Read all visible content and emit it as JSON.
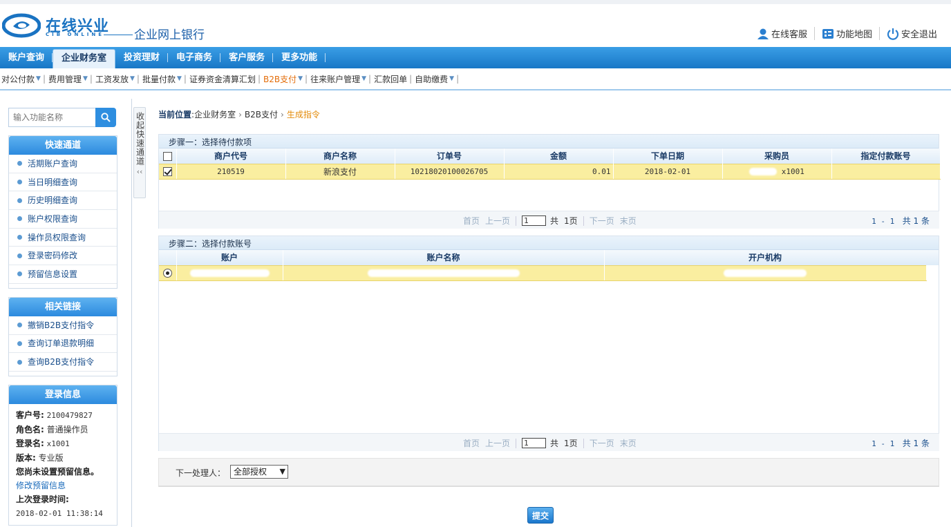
{
  "header": {
    "logo_text": "在线兴业",
    "logo_sub": "CIB ONLINE",
    "title": "企业网上银行",
    "links": [
      {
        "label": "在线客服",
        "icon": "customer-service-icon"
      },
      {
        "label": "功能地图",
        "icon": "function-map-icon"
      },
      {
        "label": "安全退出",
        "icon": "power-icon"
      }
    ]
  },
  "main_nav": [
    "账户查询",
    "企业财务室",
    "投资理财",
    "电子商务",
    "客户服务",
    "更多功能"
  ],
  "main_nav_active": "企业财务室",
  "sub_nav": [
    "对公付款",
    "费用管理",
    "工资发放",
    "批量付款",
    "证券资金清算汇划",
    "B2B支付",
    "往来账户管理",
    "汇款回单",
    "自助缴费"
  ],
  "sub_nav_active": "B2B支付",
  "sidebar": {
    "search_placeholder": "输入功能名称",
    "collapse_label": "收起快速通道",
    "quick": {
      "title": "快速通道",
      "items": [
        "活期账户查询",
        "当日明细查询",
        "历史明细查询",
        "账户权限查询",
        "操作员权限查询",
        "登录密码修改",
        "预留信息设置"
      ]
    },
    "related": {
      "title": "相关链接",
      "items": [
        "撤销B2B支付指令",
        "查询订单退款明细",
        "查询B2B支付指令"
      ]
    },
    "login": {
      "title": "登录信息",
      "customer_no_label": "客户号:",
      "customer_no": "2100479827",
      "role_label": "角色名:",
      "role": "普通操作员",
      "login_name_label": "登录名:",
      "login_name": "x1001",
      "version_label": "版本:",
      "version": "专业版",
      "notice": "您尚未设置预留信息。",
      "modify_link": "修改预留信息",
      "last_login_label": "上次登录时间:",
      "last_login": "2018-02-01 11:38:14"
    }
  },
  "breadcrumb": {
    "label": "当前位置",
    "path": [
      "企业财务室",
      "B2B支付"
    ],
    "current": "生成指令"
  },
  "step1": {
    "title": "步骤一：选择待付款项",
    "columns": [
      "商户代号",
      "商户名称",
      "订单号",
      "金额",
      "下单日期",
      "采购员",
      "指定付款账号"
    ],
    "rows": [
      {
        "checked": true,
        "merchant_code": "210519",
        "merchant_name": "新浪支付",
        "order_no": "10218020100026705",
        "amount": "0.01",
        "date": "2018-02-01",
        "buyer": "x1001",
        "account": ""
      }
    ]
  },
  "pager": {
    "first": "首页",
    "prev": "上一页",
    "page": "1",
    "total_prefix": "共",
    "total_pages": "1页",
    "next": "下一页",
    "last": "末页",
    "range": "1 - 1",
    "count": "共 1 条"
  },
  "step2": {
    "title": "步骤二：选择付款账号",
    "columns": [
      "账户",
      "账户名称",
      "开户机构"
    ],
    "rows": [
      {
        "selected": true
      }
    ]
  },
  "next_handler": {
    "label": "下一处理人：",
    "value": "全部授权"
  },
  "submit_label": "提交"
}
